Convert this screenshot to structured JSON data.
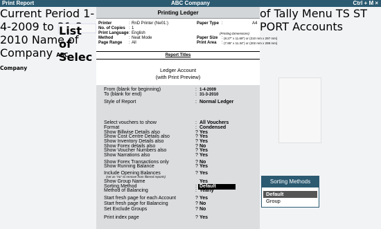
{
  "titlebar": {
    "left": "Print Report",
    "center": "ABC Company",
    "right": "Ctrl + M ×"
  },
  "background": {
    "current_period_label": "Current Period",
    "current_period_value": "1-4-2009 to 31-3-2010",
    "list_of_selected": "List of Selec",
    "name_of_company": "Name of Company",
    "company_name": "ABC Company",
    "right_fragments": [
      "of Tally",
      "Menu",
      "TS",
      "ST",
      "PORT",
      "Accounts"
    ]
  },
  "dialog": {
    "title": "Printing Ledger",
    "printer": {
      "label": "Printer",
      "value": "RnD Printer (Ne01:)"
    },
    "copies": {
      "label": "No. of Copies",
      "value": "1"
    },
    "language": {
      "label": "Print Language",
      "value": "English"
    },
    "method": {
      "label": "Method",
      "value": "Neat Mode"
    },
    "page_range": {
      "label": "Page Range",
      "value": "All"
    },
    "paper_type": {
      "label": "Paper Type",
      "value": "A4"
    },
    "printing_dimensions": "(Printing Dimensions)",
    "paper_size": {
      "label": "Paper Size",
      "value": "(8.27\" x 11.69\") or (210 mm x 297 mm)"
    },
    "print_area": {
      "label": "Print Area",
      "value": "(7.95\" x 11.34\") or (202 mm x 288 mm)"
    },
    "report_titles_label": "Report Titles",
    "report_title_line1": "Ledger Account",
    "report_title_line2": "(with Print Preview)",
    "options": {
      "from": {
        "label": "From (blank for beginning)",
        "value": "1-4-2009"
      },
      "to": {
        "label": "To (blank for end)",
        "value": "31-3-2010"
      },
      "style": {
        "label": "Style of Report",
        "value": "Normal Ledger"
      },
      "select_vouchers": {
        "label": "Select vouchers to show",
        "value": "All Vouchers"
      },
      "format": {
        "label": "Format",
        "value": "Condensed"
      },
      "billwise": {
        "label": "Show Billwise Details also",
        "value": "Yes"
      },
      "cost_centre": {
        "label": "Show Cost Centre Details also",
        "value": "Yes"
      },
      "inventory": {
        "label": "Show Inventory Details also",
        "value": "Yes"
      },
      "forex": {
        "label": "Show Forex details also",
        "value": "No"
      },
      "voucher_numbers": {
        "label": "Show Voucher Numbers also",
        "value": "Yes"
      },
      "narrations": {
        "label": "Show Narrations also",
        "value": "Yes"
      },
      "forex_transactions": {
        "label": "Show Forex Transactions only",
        "value": "No"
      },
      "running_balance": {
        "label": "Show Running Balance",
        "value": "Yes"
      },
      "opening_balances": {
        "label": "Include Opening Balances",
        "value": "Yes"
      },
      "opening_hint": "(set as \"no\" to remove from filtered reports)",
      "group_name": {
        "label": "Show Group Name",
        "value": "Yes"
      },
      "sorting_method": {
        "label": "Sorting Method",
        "value": "Default"
      },
      "balancing": {
        "label": "Method of Balancing",
        "value": "Yearly"
      },
      "fresh_page_account": {
        "label": "Start fresh page for each Account",
        "value": "Yes"
      },
      "fresh_page_balancing": {
        "label": "Start fresh page for Balancing",
        "value": "No"
      },
      "exclude_groups": {
        "label": "Set Exclude Groups",
        "value": "No"
      },
      "index_page": {
        "label": "Print index page",
        "value": "Yes"
      }
    }
  },
  "popup": {
    "title": "Sorting Methods",
    "items": [
      "Default",
      "Group"
    ],
    "selected_index": 0
  },
  "colors": {
    "titlebar": "#2b5a71",
    "dialog_title_bg": "#d3d6d8",
    "options_bg": "#dbdddf",
    "selection_bg": "#000000"
  }
}
